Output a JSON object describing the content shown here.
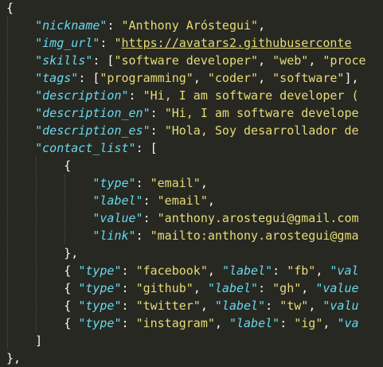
{
  "editor": {
    "theme": {
      "background": "#272822",
      "punctuation": "#f8f8f2",
      "key": "#66d9ef",
      "string": "#e6db74"
    },
    "lines": [
      {
        "indent": 0,
        "tokens": [
          {
            "t": "p",
            "v": "{"
          }
        ]
      },
      {
        "indent": 1,
        "tokens": [
          {
            "t": "k",
            "v": "\"nickname\""
          },
          {
            "t": "p",
            "v": ": "
          },
          {
            "t": "s",
            "v": "\"Anthony Aróstegui\""
          },
          {
            "t": "p",
            "v": ","
          }
        ]
      },
      {
        "indent": 1,
        "tokens": [
          {
            "t": "k",
            "v": "\"img_url\""
          },
          {
            "t": "p",
            "v": ": "
          },
          {
            "t": "s",
            "v": "\""
          },
          {
            "t": "u",
            "v": "https://avatars2.githubuserconte"
          }
        ]
      },
      {
        "indent": 1,
        "tokens": [
          {
            "t": "k",
            "v": "\"skills\""
          },
          {
            "t": "p",
            "v": ": ["
          },
          {
            "t": "s",
            "v": "\"software developer\""
          },
          {
            "t": "p",
            "v": ", "
          },
          {
            "t": "s",
            "v": "\"web\""
          },
          {
            "t": "p",
            "v": ", "
          },
          {
            "t": "s",
            "v": "\"proce"
          }
        ]
      },
      {
        "indent": 1,
        "tokens": [
          {
            "t": "k",
            "v": "\"tags\""
          },
          {
            "t": "p",
            "v": ": ["
          },
          {
            "t": "s",
            "v": "\"programming\""
          },
          {
            "t": "p",
            "v": ", "
          },
          {
            "t": "s",
            "v": "\"coder\""
          },
          {
            "t": "p",
            "v": ", "
          },
          {
            "t": "s",
            "v": "\"software\""
          },
          {
            "t": "p",
            "v": "],"
          }
        ]
      },
      {
        "indent": 1,
        "tokens": [
          {
            "t": "k",
            "v": "\"description\""
          },
          {
            "t": "p",
            "v": ": "
          },
          {
            "t": "s",
            "v": "\"Hi, I am software developer ("
          }
        ]
      },
      {
        "indent": 1,
        "tokens": [
          {
            "t": "k",
            "v": "\"description_en\""
          },
          {
            "t": "p",
            "v": ": "
          },
          {
            "t": "s",
            "v": "\"Hi, I am software develope"
          }
        ]
      },
      {
        "indent": 1,
        "tokens": [
          {
            "t": "k",
            "v": "\"description_es\""
          },
          {
            "t": "p",
            "v": ": "
          },
          {
            "t": "s",
            "v": "\"Hola, Soy desarrollador de"
          }
        ]
      },
      {
        "indent": 1,
        "tokens": [
          {
            "t": "k",
            "v": "\"contact_list\""
          },
          {
            "t": "p",
            "v": ": ["
          }
        ]
      },
      {
        "indent": 2,
        "tokens": [
          {
            "t": "p",
            "v": "{"
          }
        ]
      },
      {
        "indent": 3,
        "tokens": [
          {
            "t": "k",
            "v": "\"type\""
          },
          {
            "t": "p",
            "v": ": "
          },
          {
            "t": "s",
            "v": "\"email\""
          },
          {
            "t": "p",
            "v": ","
          }
        ]
      },
      {
        "indent": 3,
        "tokens": [
          {
            "t": "k",
            "v": "\"label\""
          },
          {
            "t": "p",
            "v": ": "
          },
          {
            "t": "s",
            "v": "\"email\""
          },
          {
            "t": "p",
            "v": ","
          }
        ]
      },
      {
        "indent": 3,
        "tokens": [
          {
            "t": "k",
            "v": "\"value\""
          },
          {
            "t": "p",
            "v": ": "
          },
          {
            "t": "s",
            "v": "\"anthony.arostegui@gmail.com"
          }
        ]
      },
      {
        "indent": 3,
        "tokens": [
          {
            "t": "k",
            "v": "\"link\""
          },
          {
            "t": "p",
            "v": ": "
          },
          {
            "t": "s",
            "v": "\"mailto:anthony.arostegui@gma"
          }
        ]
      },
      {
        "indent": 2,
        "tokens": [
          {
            "t": "p",
            "v": "},"
          }
        ]
      },
      {
        "indent": 2,
        "tokens": [
          {
            "t": "p",
            "v": "{ "
          },
          {
            "t": "k",
            "v": "\"type\""
          },
          {
            "t": "p",
            "v": ": "
          },
          {
            "t": "s",
            "v": "\"facebook\""
          },
          {
            "t": "p",
            "v": ", "
          },
          {
            "t": "k",
            "v": "\"label\""
          },
          {
            "t": "p",
            "v": ": "
          },
          {
            "t": "s",
            "v": "\"fb\""
          },
          {
            "t": "p",
            "v": ", "
          },
          {
            "t": "k",
            "v": "\"val"
          }
        ]
      },
      {
        "indent": 2,
        "tokens": [
          {
            "t": "p",
            "v": "{ "
          },
          {
            "t": "k",
            "v": "\"type\""
          },
          {
            "t": "p",
            "v": ": "
          },
          {
            "t": "s",
            "v": "\"github\""
          },
          {
            "t": "p",
            "v": ", "
          },
          {
            "t": "k",
            "v": "\"label\""
          },
          {
            "t": "p",
            "v": ": "
          },
          {
            "t": "s",
            "v": "\"gh\""
          },
          {
            "t": "p",
            "v": ", "
          },
          {
            "t": "k",
            "v": "\"value"
          }
        ]
      },
      {
        "indent": 2,
        "tokens": [
          {
            "t": "p",
            "v": "{ "
          },
          {
            "t": "k",
            "v": "\"type\""
          },
          {
            "t": "p",
            "v": ": "
          },
          {
            "t": "s",
            "v": "\"twitter\""
          },
          {
            "t": "p",
            "v": ", "
          },
          {
            "t": "k",
            "v": "\"label\""
          },
          {
            "t": "p",
            "v": ": "
          },
          {
            "t": "s",
            "v": "\"tw\""
          },
          {
            "t": "p",
            "v": ", "
          },
          {
            "t": "k",
            "v": "\"valu"
          }
        ]
      },
      {
        "indent": 2,
        "tokens": [
          {
            "t": "p",
            "v": "{ "
          },
          {
            "t": "k",
            "v": "\"type\""
          },
          {
            "t": "p",
            "v": ": "
          },
          {
            "t": "s",
            "v": "\"instagram\""
          },
          {
            "t": "p",
            "v": ", "
          },
          {
            "t": "k",
            "v": "\"label\""
          },
          {
            "t": "p",
            "v": ": "
          },
          {
            "t": "s",
            "v": "\"ig\""
          },
          {
            "t": "p",
            "v": ", "
          },
          {
            "t": "k",
            "v": "\"va"
          }
        ]
      },
      {
        "indent": 1,
        "tokens": [
          {
            "t": "p",
            "v": "]"
          }
        ]
      },
      {
        "indent": 0,
        "tokens": [
          {
            "t": "p",
            "v": "},"
          }
        ]
      }
    ]
  }
}
